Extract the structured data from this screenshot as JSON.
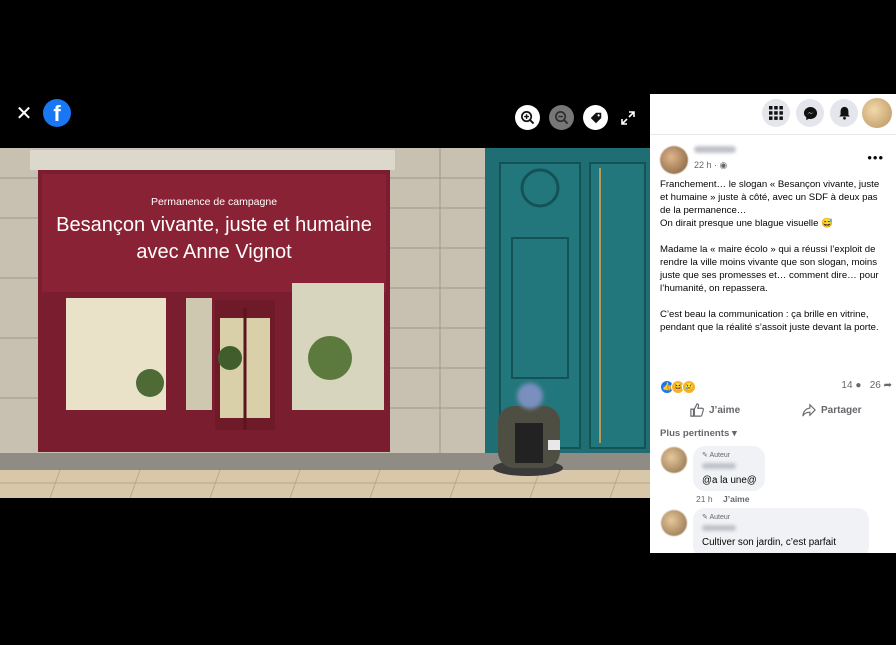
{
  "viewer": {
    "close_icon": "close-icon",
    "logo_icon": "facebook-logo",
    "tools": [
      "zoom-in-icon",
      "zoom-out-icon",
      "tag-icon",
      "fullscreen-icon"
    ]
  },
  "photo": {
    "sign_small": "Permanence de campagne",
    "sign_line1": "Besançon vivante, juste et humaine",
    "sign_line2": "avec Anne Vignot",
    "colors": {
      "facade": "#7a1d2e",
      "door": "#1f6e73",
      "stone": "#c9c3b5"
    }
  },
  "topbar": {
    "icons": [
      "menu-grid-icon",
      "messenger-icon",
      "bell-icon",
      "profile-avatar"
    ]
  },
  "post": {
    "time": "22 h · ",
    "paragraphs": [
      "Franchement… le slogan « Besançon vivante, juste et humaine » juste à côté, avec un SDF à deux pas de la permanence…",
      "On dirait presque une blague visuelle 😅",
      "Madame la « maire écolo » qui a réussi l’exploit de rendre la ville moins vivante que son slogan, moins juste que ses promesses et… comment dire… pour l’humanité, on repassera.",
      "C’est beau la communication : ça brille en vitrine, pendant que la réalité s’assoit juste devant la porte."
    ],
    "comment_count": "14",
    "share_count": "26",
    "like_label": "J’aime",
    "share_label": "Partager"
  },
  "comments": {
    "sort_label": "Plus pertinents",
    "items": [
      {
        "author_label": "Auteur",
        "text": "@a la une@",
        "time": "21 h",
        "like": "J’aime"
      },
      {
        "author_label": "Auteur",
        "text": "Cultiver son jardin, c’est parfait"
      }
    ]
  },
  "colors": {
    "accent": "#1877f2",
    "text_secondary": "#65676b"
  }
}
